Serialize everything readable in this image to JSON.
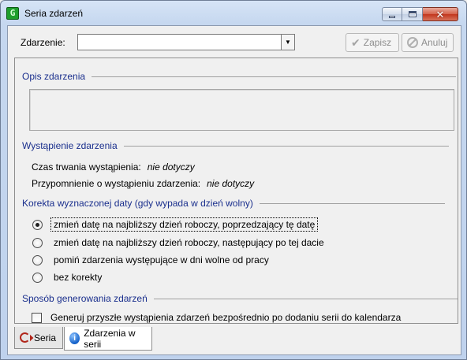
{
  "window": {
    "title": "Seria zdarzeń",
    "app_icon": "calendar-app-icon"
  },
  "toolbar": {
    "event_label": "Zdarzenie:",
    "event_value": "",
    "save_label": "Zapisz",
    "cancel_label": "Anuluj"
  },
  "sections": {
    "description": "Opis zdarzenia",
    "occurrence": "Wystąpienie zdarzenia",
    "correction": "Korekta wyznaczonej daty (gdy wypada w dzień wolny)",
    "generation": "Sposób generowania zdarzeń"
  },
  "occurrence": {
    "duration_label": "Czas trwania wystąpienia:",
    "duration_value": "nie dotyczy",
    "reminder_label": "Przypomnienie o wystąpieniu zdarzenia:",
    "reminder_value": "nie dotyczy"
  },
  "correction_options": [
    {
      "label": "zmień datę na najbliższy dzień roboczy, poprzedzający tę datę",
      "checked": true
    },
    {
      "label": "zmień datę na najbliższy dzień roboczy, następujący po tej dacie",
      "checked": false
    },
    {
      "label": "pomiń zdarzenia występujące w dni wolne od pracy",
      "checked": false
    },
    {
      "label": "bez korekty",
      "checked": false
    }
  ],
  "generation": {
    "checkbox_label": "Generuj przyszłe wystąpienia zdarzeń bezpośrednio po dodaniu serii do kalendarza",
    "checked": false
  },
  "tabs": [
    {
      "label": "Seria",
      "icon": "series-icon",
      "active": false
    },
    {
      "label": "Zdarzenia w serii",
      "icon": "info-icon",
      "active": true
    }
  ]
}
